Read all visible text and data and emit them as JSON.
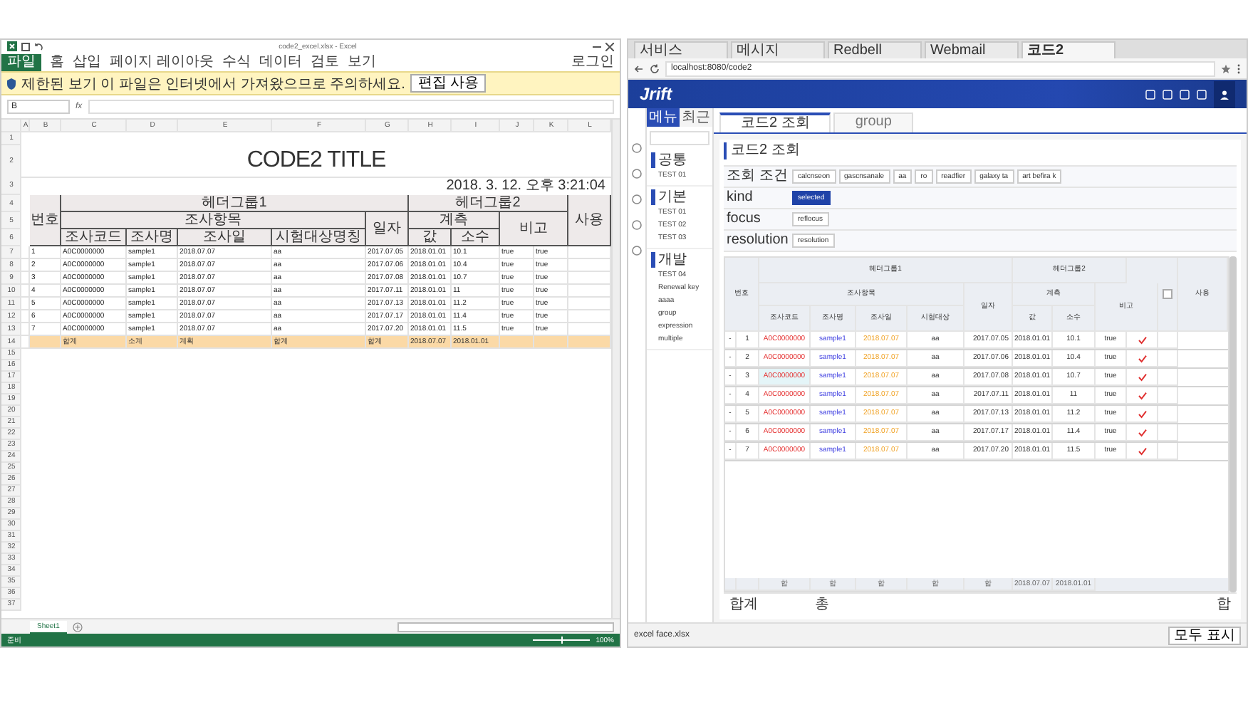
{
  "excel": {
    "title": "code2_excel.xlsx - Excel",
    "ribbon_tabs": [
      {
        "label": "파일",
        "selected": true
      },
      {
        "label": "홈",
        "selected": false
      },
      {
        "label": "삽입",
        "selected": false
      },
      {
        "label": "페이지 레이아웃",
        "selected": false
      },
      {
        "label": "수식",
        "selected": false
      },
      {
        "label": "데이터",
        "selected": false
      },
      {
        "label": "검토",
        "selected": false
      },
      {
        "label": "보기",
        "selected": false
      }
    ],
    "account": "로그인",
    "protected_view": {
      "message": "제한된 보기 이 파일은 인터넷에서 가져왔으므로 주의하세요.",
      "button": "편집 사용"
    },
    "name_box": "B",
    "formula_icon": "fx",
    "column_letters": [
      "A",
      "B",
      "C",
      "D",
      "E",
      "F",
      "G",
      "H",
      "I",
      "J",
      "K",
      "L"
    ],
    "row_numbers": [
      "1",
      "2",
      "3",
      "4",
      "5",
      "6",
      "7",
      "8",
      "9",
      "10",
      "11",
      "12",
      "13",
      "14",
      "15",
      "16",
      "17",
      "18",
      "19",
      "20",
      "21",
      "22",
      "23",
      "24",
      "25",
      "26",
      "27",
      "28",
      "29",
      "30",
      "31",
      "32",
      "33",
      "34",
      "35",
      "36",
      "37"
    ],
    "sheet": {
      "title": "CODE2 TITLE",
      "timestamp": "2018. 3. 12. 오후 3:21:04",
      "headers": {
        "no": "번호",
        "group1": "헤더그룹1",
        "item": "조사항목",
        "code": "조사코드",
        "name": "조사명",
        "date": "조사일",
        "target": "시험대상명칭",
        "day": "일자",
        "group2": "헤더그룹2",
        "measure": "계측",
        "value": "값",
        "decimal": "소수",
        "note": "비고",
        "use": "사용"
      },
      "rows": [
        {
          "no": "1",
          "code": "A0C0000000",
          "name": "sample1",
          "date": "2018.07.07",
          "target": "aa",
          "day": "2017.07.05",
          "day2": "2018.01.01",
          "value": "10.1",
          "flag1": "true",
          "flag2": "true"
        },
        {
          "no": "2",
          "code": "A0C0000000",
          "name": "sample1",
          "date": "2018.07.07",
          "target": "aa",
          "day": "2017.07.06",
          "day2": "2018.01.01",
          "value": "10.4",
          "flag1": "true",
          "flag2": "true"
        },
        {
          "no": "3",
          "code": "A0C0000000",
          "name": "sample1",
          "date": "2018.07.07",
          "target": "aa",
          "day": "2017.07.08",
          "day2": "2018.01.01",
          "value": "10.7",
          "flag1": "true",
          "flag2": "true"
        },
        {
          "no": "4",
          "code": "A0C0000000",
          "name": "sample1",
          "date": "2018.07.07",
          "target": "aa",
          "day": "2017.07.11",
          "day2": "2018.01.01",
          "value": "11",
          "flag1": "true",
          "flag2": "true"
        },
        {
          "no": "5",
          "code": "A0C0000000",
          "name": "sample1",
          "date": "2018.07.07",
          "target": "aa",
          "day": "2017.07.13",
          "day2": "2018.01.01",
          "value": "11.2",
          "flag1": "true",
          "flag2": "true"
        },
        {
          "no": "6",
          "code": "A0C0000000",
          "name": "sample1",
          "date": "2018.07.07",
          "target": "aa",
          "day": "2017.07.17",
          "day2": "2018.01.01",
          "value": "11.4",
          "flag1": "true",
          "flag2": "true"
        },
        {
          "no": "7",
          "code": "A0C0000000",
          "name": "sample1",
          "date": "2018.07.07",
          "target": "aa",
          "day": "2017.07.20",
          "day2": "2018.01.01",
          "value": "11.5",
          "flag1": "true",
          "flag2": "true"
        }
      ],
      "total": [
        "합계",
        "소계",
        "계획",
        "합계",
        "합계",
        "2018.07.07",
        "2018.01.01"
      ]
    },
    "sheet_tab": "Sheet1",
    "status": {
      "ready": "준비",
      "zoom": "100%",
      "zoom_slider": {
        "level": 0.5
      }
    }
  },
  "browser": {
    "tabs": [
      {
        "title": "서비스",
        "selected": false
      },
      {
        "title": "메시지",
        "selected": false
      },
      {
        "title": "Redbell",
        "selected": false
      },
      {
        "title": "Webmail",
        "selected": false
      },
      {
        "title": "코드2",
        "selected": true
      }
    ],
    "url": "localhost:8080/code2",
    "logo": "Jrift",
    "sidebar": {
      "tabs": [
        {
          "label": "메뉴",
          "selected": true
        },
        {
          "label": "최근",
          "selected": false
        }
      ],
      "groups": [
        {
          "label": "공통",
          "items": [
            "TEST 01"
          ]
        },
        {
          "label": "기본",
          "items": [
            "TEST 01",
            "TEST 02",
            "TEST 03"
          ]
        },
        {
          "label": "개발",
          "items": [
            "TEST 04",
            "Renewal key",
            "aaaa",
            "group",
            "expression",
            "multiple"
          ]
        }
      ]
    },
    "content_tabs": [
      {
        "label": "코드2 조회",
        "selected": true
      },
      {
        "label": "group",
        "selected": false
      }
    ],
    "page_title": "코드2 조회",
    "filters": [
      {
        "label": "조회 조건",
        "chips": [
          {
            "label": "calcnseon",
            "selected": false
          },
          {
            "label": "gascnsanale",
            "selected": false
          },
          {
            "label": "aa",
            "selected": false
          },
          {
            "label": "ro",
            "selected": false
          },
          {
            "label": "readfier",
            "selected": false
          },
          {
            "label": "galaxy ta",
            "selected": false
          },
          {
            "label": "art befira k",
            "selected": false
          }
        ]
      },
      {
        "label": "kind",
        "chips": [
          {
            "label": "selected",
            "selected": true
          }
        ]
      },
      {
        "label": "focus",
        "chips": [
          {
            "label": "reflocus",
            "selected": false
          }
        ]
      },
      {
        "label": "resolution",
        "chips": [
          {
            "label": "resolution",
            "selected": false
          }
        ]
      }
    ],
    "table": {
      "headers": {
        "no": "번호",
        "group1": "헤더그룹1",
        "item": "조사항목",
        "code": "조사코드",
        "name": "조사명",
        "date": "조사일",
        "target": "시험대상",
        "day": "일자",
        "group2": "헤더그룹2",
        "measure": "계측",
        "value": "값",
        "decimal": "소수",
        "note": "비고",
        "use": "사용"
      },
      "all_checked": false,
      "row_handle": "-",
      "rows": [
        {
          "no": "1",
          "code": "A0C0000000",
          "name": "sample1",
          "date": "2018.07.07",
          "target": "aa",
          "day": "2017.07.05",
          "day2": "2018.01.01",
          "value": "10.1",
          "note": "true",
          "checked": true,
          "focused": false
        },
        {
          "no": "2",
          "code": "A0C0000000",
          "name": "sample1",
          "date": "2018.07.07",
          "target": "aa",
          "day": "2017.07.06",
          "day2": "2018.01.01",
          "value": "10.4",
          "note": "true",
          "checked": true,
          "focused": false
        },
        {
          "no": "3",
          "code": "A0C0000000",
          "name": "sample1",
          "date": "2018.07.07",
          "target": "aa",
          "day": "2017.07.08",
          "day2": "2018.01.01",
          "value": "10.7",
          "note": "true",
          "checked": true,
          "focused": true
        },
        {
          "no": "4",
          "code": "A0C0000000",
          "name": "sample1",
          "date": "2018.07.07",
          "target": "aa",
          "day": "2017.07.11",
          "day2": "2018.01.01",
          "value": "11",
          "note": "true",
          "checked": true,
          "focused": false
        },
        {
          "no": "5",
          "code": "A0C0000000",
          "name": "sample1",
          "date": "2018.07.07",
          "target": "aa",
          "day": "2017.07.13",
          "day2": "2018.01.01",
          "value": "11.2",
          "note": "true",
          "checked": true,
          "focused": false
        },
        {
          "no": "6",
          "code": "A0C0000000",
          "name": "sample1",
          "date": "2018.07.07",
          "target": "aa",
          "day": "2017.07.17",
          "day2": "2018.01.01",
          "value": "11.4",
          "note": "true",
          "checked": true,
          "focused": false
        },
        {
          "no": "7",
          "code": "A0C0000000",
          "name": "sample1",
          "date": "2018.07.07",
          "target": "aa",
          "day": "2017.07.20",
          "day2": "2018.01.01",
          "value": "11.5",
          "note": "true",
          "checked": true,
          "focused": false
        }
      ],
      "footer": [
        "합",
        "합",
        "합",
        "합",
        "합",
        "2018.07.07",
        "2018.01.01"
      ]
    },
    "summary": {
      "label": "합계",
      "count": "총",
      "sum": "합"
    },
    "download": {
      "file": "excel face.xlsx",
      "show_all": "모두 표시"
    }
  }
}
